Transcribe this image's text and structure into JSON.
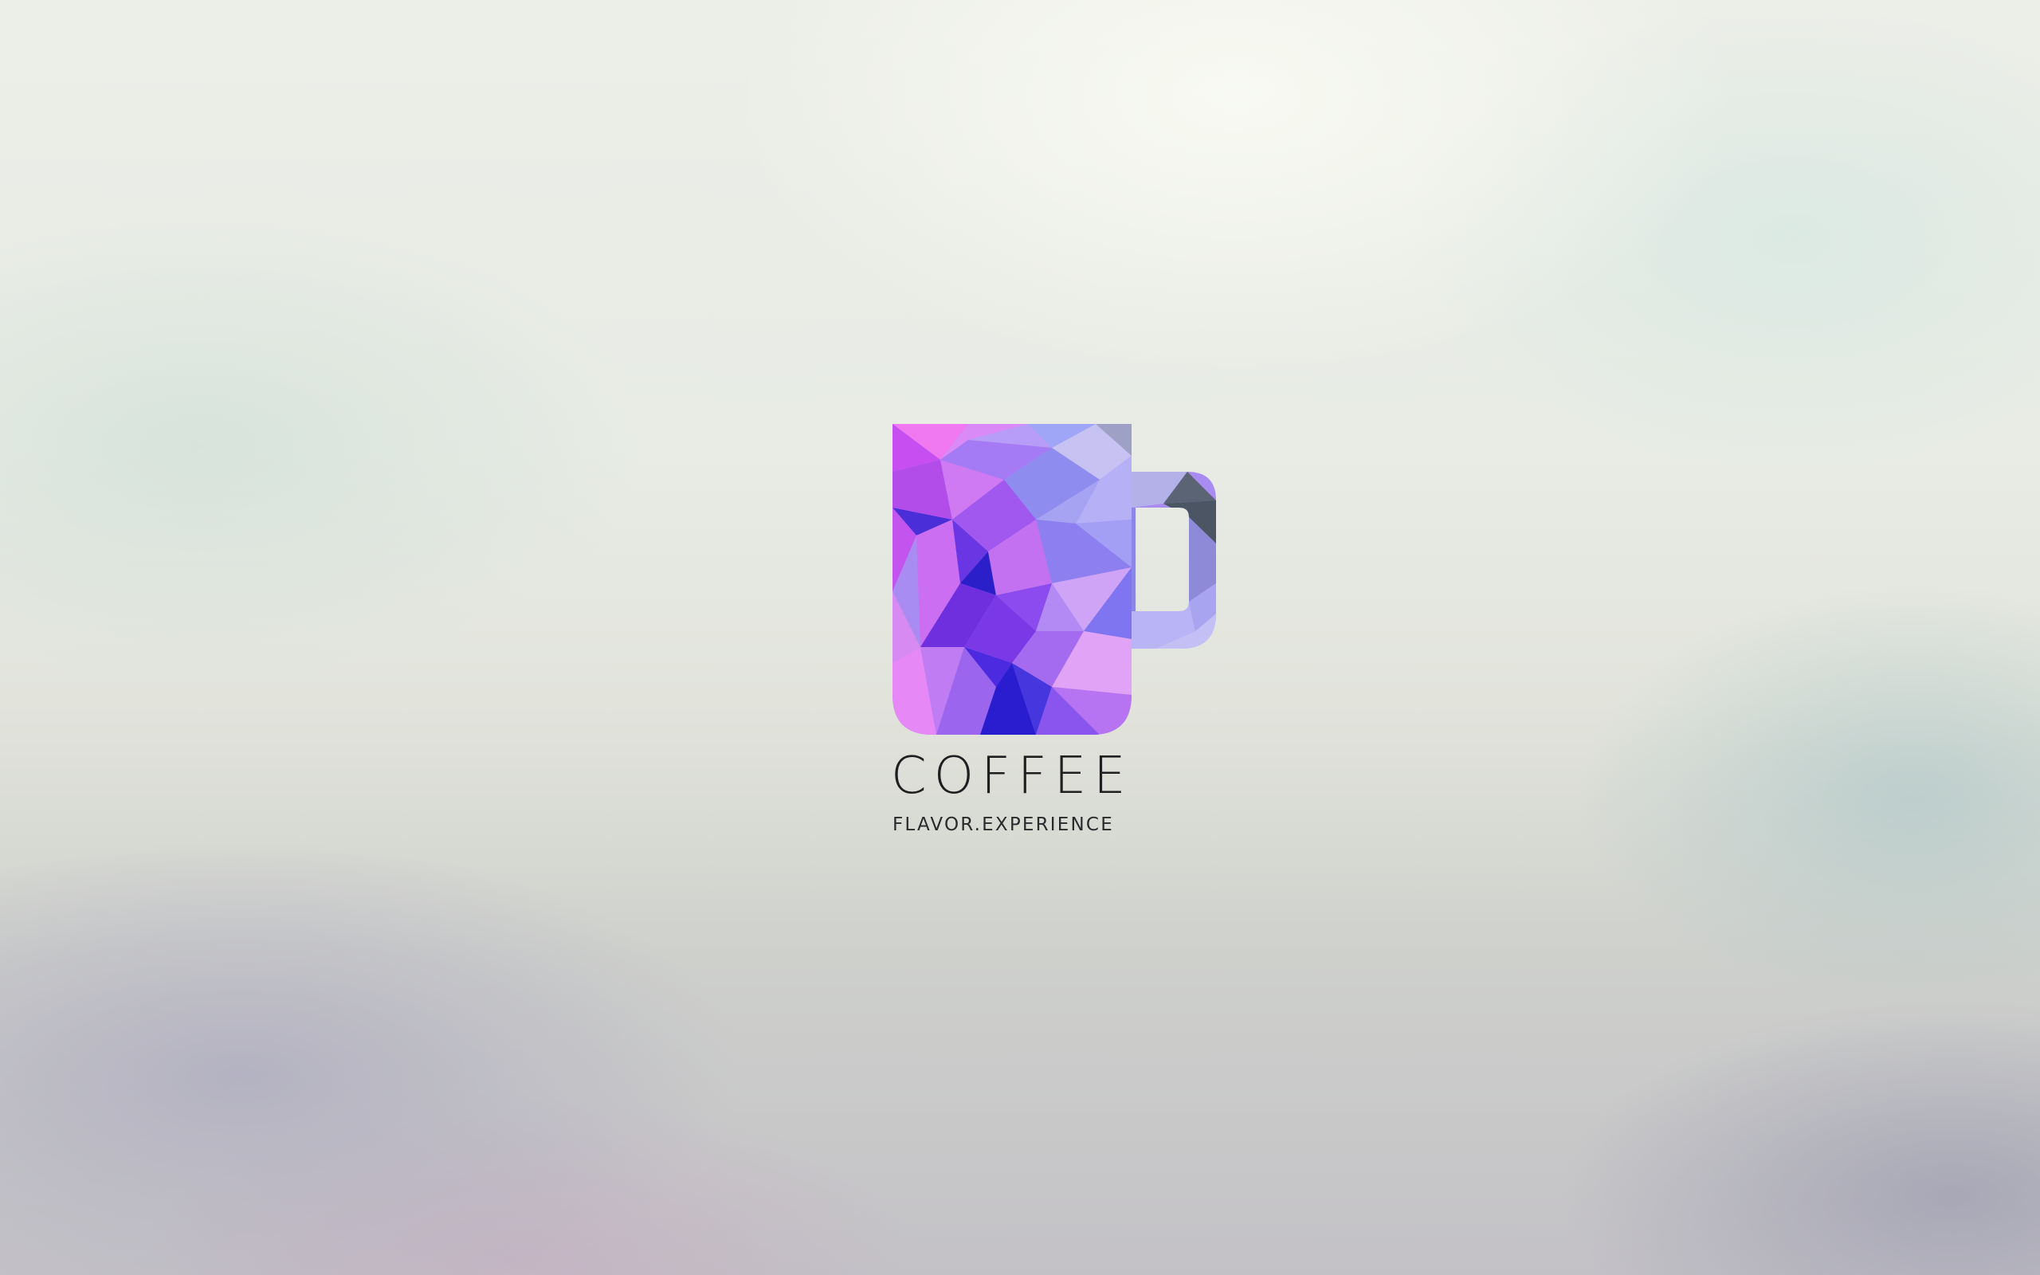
{
  "wallpaper": {
    "logo": {
      "icon": "coffee-mug-icon",
      "brand_name": "COFFEE",
      "tagline": "FLAVOR.EXPERIENCE"
    },
    "colors": {
      "mug_pink": "#e07cf0",
      "mug_purple": "#9b55ee",
      "mug_blue": "#3a22d6",
      "mug_lavender": "#a9a0f5",
      "handle_slate": "#4a5568",
      "text": "#1f1f22"
    }
  }
}
